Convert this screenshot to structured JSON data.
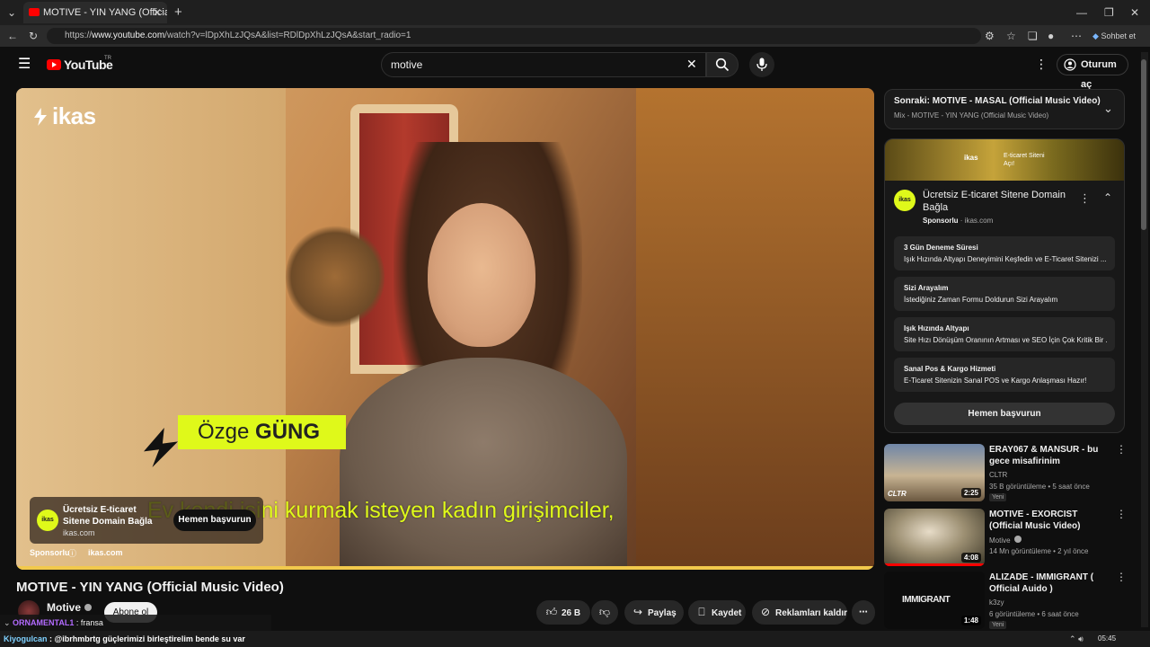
{
  "browser": {
    "tab_title": "MOTIVE - YIN YANG (Official Music Video) - YouTube",
    "url_prefix": "https://",
    "url_host": "www.youtube.com",
    "url_path": "/watch?v=lDpXhLzJQsA&list=RDlDpXhLzJQsA&start_radio=1",
    "chat_button": "Sohbet et"
  },
  "header": {
    "logo_text": "YouTube",
    "logo_region": "TR",
    "search_value": "motive",
    "signin_label": "Oturum aç"
  },
  "video": {
    "brand_overlay": "ikas",
    "lower_third_first": "Özge ",
    "lower_third_last": "GÜNG",
    "subtitle": "Ev kendi işini kurmak isteyen kadın girişimciler,",
    "ad_card": {
      "logo": "ikas",
      "title": "Ücretsiz E-ticaret Sitene Domain Bağla",
      "domain": "ikas.com",
      "button": "Hemen başvurun"
    },
    "sponsored_label": "Sponsorlu",
    "sponsored_domain": "ikas.com",
    "progress_fraction": 1.0
  },
  "below": {
    "title": "MOTIVE - YIN YANG (Official Music Video)",
    "channel": "Motive",
    "subscribe_label": "Abone ol",
    "like_count": "26 B",
    "share_label": "Paylaş",
    "save_label": "Kaydet",
    "remove_ads_label": "Reklamları kaldır"
  },
  "next": {
    "label": "Sonraki:",
    "title": "MOTIVE - MASAL (Official Music Video)",
    "playlist": "Mix - MOTIVE - YIN YANG (Official Music Video)"
  },
  "ad_panel": {
    "banner_ikas": "ikas",
    "banner_line1": "E-ticaret Siteni",
    "banner_line2": "Açı!",
    "logo": "ikas",
    "title": "Ücretsiz E-ticaret Sitene Domain Bağla",
    "sponsor_label": "Sponsorlu",
    "sponsor_domain": "· ikas.com",
    "features": [
      {
        "title": "3 Gün Deneme Süresi",
        "desc": "Işık Hızında Altyapı Deneyimini Keşfedin ve E-Ticaret Sitenizi ..."
      },
      {
        "title": "Sizi Arayalım",
        "desc": "İstediğiniz Zaman Formu Doldurun Sizi Arayalım"
      },
      {
        "title": "Işık Hızında Altyapı",
        "desc": "Site Hızı Dönüşüm Oranının Artması ve SEO İçin Çok Kritik Bir ..."
      },
      {
        "title": "Sanal Pos & Kargo Hizmeti",
        "desc": "E-Ticaret Sitenizin Sanal POS ve Kargo Anlaşması Hazır!"
      }
    ],
    "apply_label": "Hemen başvurun"
  },
  "recommendations": [
    {
      "title": "ERAY067 & MANSUR - bu gece misafirinim",
      "channel": "CLTR",
      "meta": "35 B görüntüleme • 5 saat önce",
      "badge": "Yeni",
      "duration": "2:25",
      "thumb_label": "CLTR"
    },
    {
      "title": "MOTIVE - EXORCIST (Official Music Video)",
      "channel": "Motive",
      "meta": "14 Mn görüntüleme • 2 yıl önce",
      "badge": "",
      "duration": "4:08",
      "thumb_label": ""
    },
    {
      "title": "ALIZADE - IMMIGRANT ( Official Auido )",
      "channel": "k3zy",
      "meta": "6 görüntüleme • 6 saat önce",
      "badge": "Yeni",
      "duration": "1:48",
      "thumb_label": "IMMIGRANT"
    }
  ],
  "chat": {
    "line1_user": "ORNAMENTAL1",
    "line1_text": " : fransa",
    "line2_user": "Kiyogulcan",
    "line2_text": " : @ibrhmbrtg güçlerimizi birleştirelim bende su var"
  },
  "taskbar": {
    "clock": "05:45"
  },
  "colors": {
    "youtube_red": "#ff0000",
    "ikas_green": "#dff91a",
    "progress": "#f2c94c"
  }
}
